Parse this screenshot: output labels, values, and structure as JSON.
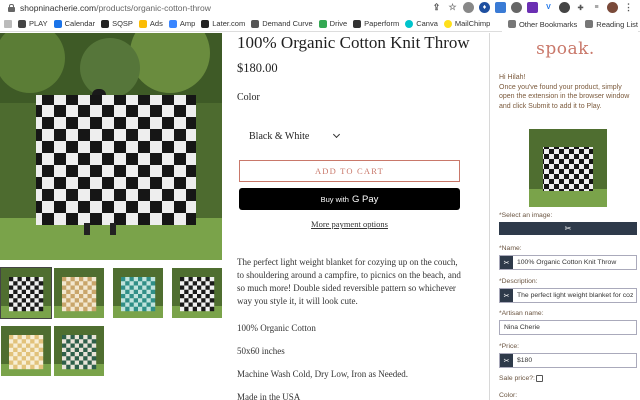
{
  "browser": {
    "url_host": "shopninacherie.com",
    "url_path": "/products/organic-cotton-throw",
    "bookmarks": [
      {
        "label": "PLAY",
        "color": "#444444"
      },
      {
        "label": "Calendar",
        "color": "#1a73e8"
      },
      {
        "label": "SQSP",
        "color": "#222222"
      },
      {
        "label": "Ads",
        "color": "#fbbc04"
      },
      {
        "label": "Amp",
        "color": "#3a86ff"
      },
      {
        "label": "Later.com",
        "color": "#222222"
      },
      {
        "label": "Demand Curve",
        "color": "#555555"
      },
      {
        "label": "Drive",
        "color": "#34a853"
      },
      {
        "label": "Paperform",
        "color": "#333333"
      },
      {
        "label": "Canva",
        "color": "#00c4cc"
      },
      {
        "label": "MailChimp",
        "color": "#ffe01b"
      }
    ],
    "other_bookmarks": "Other Bookmarks",
    "reading_list": "Reading List"
  },
  "product": {
    "title": "100% Organic Cotton Knit Throw",
    "price": "$180.00",
    "color_label": "Color",
    "color_value": "Black & White",
    "add_to_cart": "ADD TO CART",
    "gpay_prefix": "Buy with",
    "gpay_brand": "G Pay",
    "more_payment": "More payment options",
    "description": "The perfect light weight blanket for cozying up on the couch, to shouldering around a campfire, to picnics on the beach, and so much more! Double sided reversible pattern so whichever way you style it, it will look cute.",
    "material": "100% Organic Cotton",
    "size": "50x60 inches",
    "care": "Machine Wash Cold, Dry Low, Iron as Needed.",
    "origin": "Made in the USA"
  },
  "gallery": {
    "thumbnails": [
      {
        "name": "black-white",
        "dark": "#1a1a1a",
        "light": "#f0f0f0"
      },
      {
        "name": "tan-cream",
        "dark": "#c9a56a",
        "light": "#f3e7cf"
      },
      {
        "name": "teal",
        "dark": "#2f8f87",
        "light": "#bfe3dd"
      },
      {
        "name": "black-white-2",
        "dark": "#1a1a1a",
        "light": "#f0f0f0"
      },
      {
        "name": "yellow-cream",
        "dark": "#e2c27a",
        "light": "#f8eed4"
      },
      {
        "name": "folded-stack",
        "dark": "#2e5f4a",
        "light": "#e8e3d8"
      }
    ]
  },
  "spoak": {
    "logo": "spoak.",
    "greeting_line1": "Hi Hilah!",
    "greeting_body": "Once you've found your product, simply open the extension in the browser window and click Submit to add it to Play.",
    "select_image_label": "*Select an image:",
    "scissors": "✂",
    "name_label": "*Name:",
    "name_value": "100% Organic Cotton Knit Throw",
    "description_label": "*Description:",
    "description_value": "The perfect light weight blanket for cozy",
    "artisan_label": "*Artisan name:",
    "artisan_value": "Nina Cherie",
    "price_label": "*Price:",
    "price_value": "$180",
    "sale_label": "Sale price?:",
    "color_label": "Color:",
    "accent": "#c9786a",
    "button_color": "#2e3a4a"
  }
}
